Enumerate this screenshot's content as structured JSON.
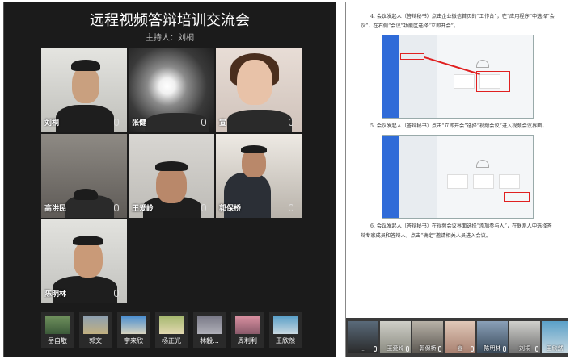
{
  "meeting": {
    "title": "远程视频答辩培训交流会",
    "host_label": "主持人：刘桐"
  },
  "video_grid": [
    {
      "name": "刘桐"
    },
    {
      "name": "张健"
    },
    {
      "name": "宣"
    },
    {
      "name": "高洪民"
    },
    {
      "name": "王爱岭"
    },
    {
      "name": "郭保桥"
    },
    {
      "name": "陈明林"
    }
  ],
  "thumbnails": [
    {
      "name": "岳自敬"
    },
    {
      "name": "郭文"
    },
    {
      "name": "宇来欣"
    },
    {
      "name": "杨正光"
    },
    {
      "name": "林毅..."
    },
    {
      "name": "周利利"
    },
    {
      "name": "王欣然"
    }
  ],
  "document": {
    "para1": "4. 会议发起人（答辩秘书）点击企业微信首页的“工作台”，在“应用程序”中选择“会议”，在右侧“会议”功能区选择“立即开会”。",
    "para2": "5. 会议发起人（答辩秘书）点击“立即开会”选择“视频会议”进入视频会议界面。",
    "para3": "6. 会议发起人（答辩秘书）在视频会议界面选择“添加参与人”，在联系人中选择答辩专家成员和答辩人，点击“确定”邀请相关人员进入会议。"
  },
  "bottom_strip": [
    {
      "name": "..."
    },
    {
      "name": "王爱岭"
    },
    {
      "name": "郭保桥"
    },
    {
      "name": "宣"
    },
    {
      "name": "陈明林"
    },
    {
      "name": "刘桐"
    },
    {
      "name": "王欣然"
    }
  ],
  "colors": {
    "panel_bg": "#1b1b1b",
    "accent_blue": "#2f6bd8",
    "highlight_red": "#e02020"
  }
}
